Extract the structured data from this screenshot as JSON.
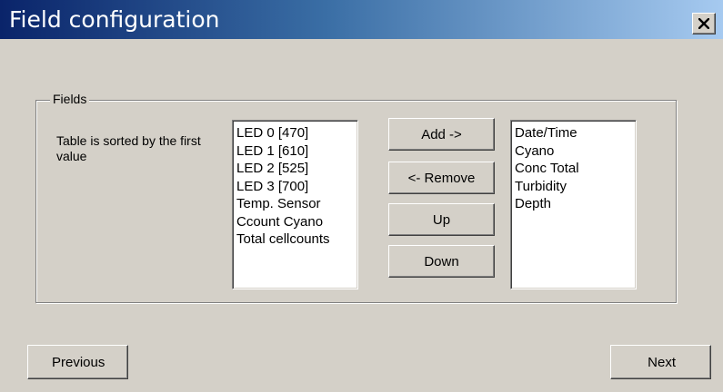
{
  "window": {
    "title": "Field configuration",
    "close_icon": "close-icon"
  },
  "fields_group": {
    "label": "Fields",
    "description": "Table is sorted by the first value",
    "available_items": [
      "LED 0 [470]",
      "LED 1 [610]",
      "LED 2 [525]",
      "LED 3 [700]",
      "Temp. Sensor",
      "Ccount Cyano",
      "Total cellcounts"
    ],
    "selected_items": [
      "Date/Time",
      "Cyano",
      "Conc Total",
      "Turbidity",
      "Depth"
    ],
    "buttons": {
      "add": "Add ->",
      "remove": "<- Remove",
      "up": "Up",
      "down": "Down"
    }
  },
  "navigation": {
    "previous": "Previous",
    "next": "Next"
  },
  "colors": {
    "dialog_bg": "#d4d0c8",
    "title_gradient_start": "#0a246a",
    "title_gradient_end": "#a6caf0",
    "title_text": "#ffffff"
  }
}
